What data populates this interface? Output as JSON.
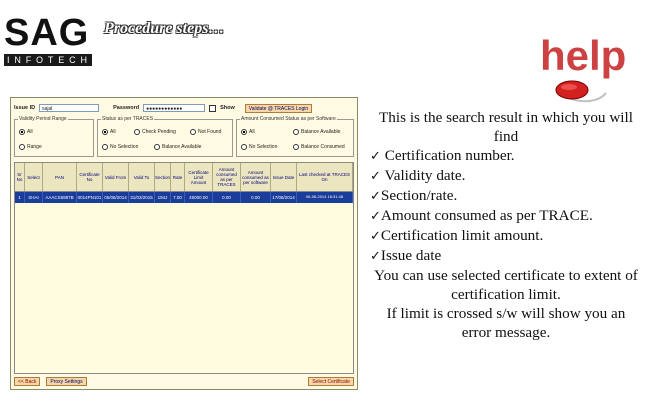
{
  "header": {
    "logo_main": "SAG",
    "logo_sub": [
      "I",
      "N",
      "F",
      "O",
      "T",
      "E",
      "C",
      "H"
    ],
    "title": "Procedure steps…",
    "help_text": "help"
  },
  "app": {
    "search_id_label": "Issue ID",
    "search_id_value": "sajal",
    "password_label": "Password",
    "password_value": "●●●●●●●●●●●●",
    "show_label": "Show",
    "validate_button": "Validate @ TRACES Login",
    "group_validity": {
      "title": "Validity Period Range",
      "options": [
        "All",
        "Range"
      ]
    },
    "group_status": {
      "title": "Status as per TRACES",
      "options": [
        "All",
        "Check Pending",
        "Not Found",
        "No Selection",
        "Balance Available"
      ]
    },
    "group_consumed": {
      "title": "Amount Consumed Status as per Software",
      "options": [
        "All",
        "Balance Available",
        "No Selection",
        "Balance Consumed"
      ]
    },
    "table": {
      "columns": [
        "Sr No",
        "Select",
        "PAN",
        "Certificate No",
        "Valid From",
        "Valid To",
        "Section",
        "Rate",
        "Certificate Limit Amount",
        "Amount consumed as per TRACES",
        "Amount consumed as per software",
        "Issue Date",
        "Last checked at TRACES On"
      ],
      "rows": [
        [
          "1",
          "SHAI",
          "AAACS5987B",
          "0014PN101",
          "05/06/2014",
          "31/03/2015",
          "194J",
          "7.00",
          "45000.00",
          "0.00",
          "0.00",
          "17/06/2014",
          "06-08-2014 16:31:48"
        ]
      ]
    },
    "back_button": "<< Back",
    "proxy_button": "Proxy Settings",
    "select_button": "Select Certificate"
  },
  "description": {
    "intro": "This is the search result in which you will find",
    "items": [
      "Certification number.",
      "Validity date.",
      "Section/rate.",
      "Amount consumed as per TRACE.",
      "Certification limit amount.",
      "Issue date"
    ],
    "outro1": "You can use selected certificate to extent of  certification limit.",
    "outro2": "If limit is crossed s/w will show you an error message."
  }
}
